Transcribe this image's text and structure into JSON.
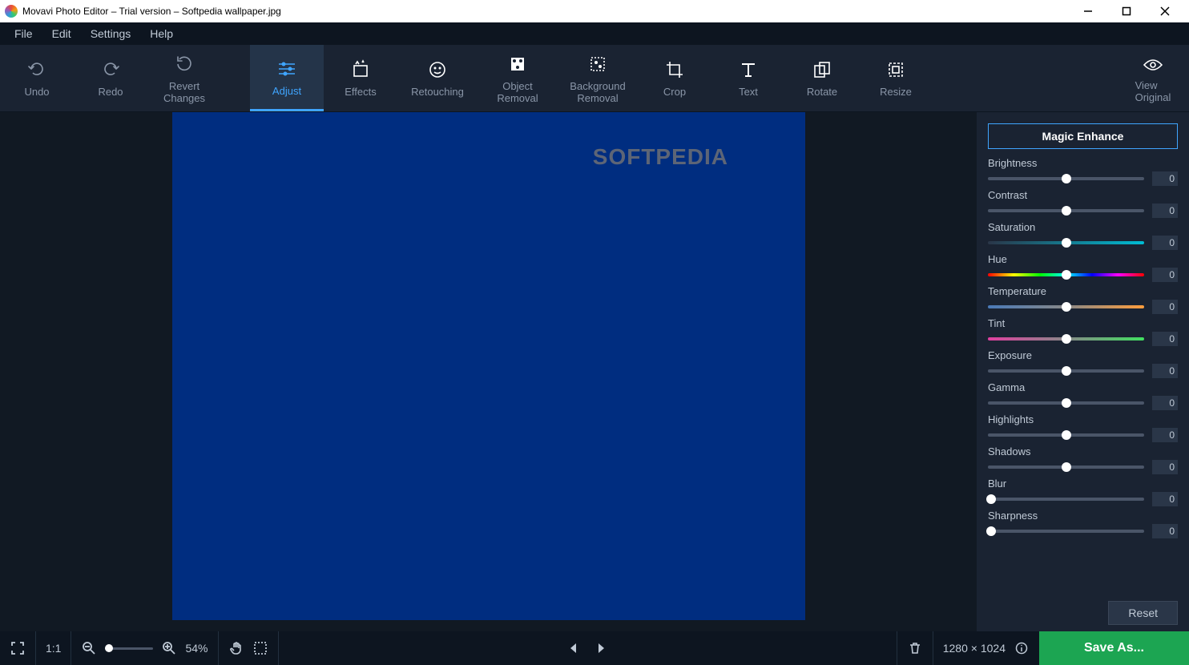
{
  "window": {
    "title": "Movavi Photo Editor – Trial version – Softpedia wallpaper.jpg"
  },
  "menu": {
    "file": "File",
    "edit": "Edit",
    "settings": "Settings",
    "help": "Help"
  },
  "toolbar": {
    "undo": "Undo",
    "redo": "Redo",
    "revert": "Revert\nChanges",
    "adjust": "Adjust",
    "effects": "Effects",
    "retouching": "Retouching",
    "object_removal": "Object\nRemoval",
    "background_removal": "Background\nRemoval",
    "crop": "Crop",
    "text": "Text",
    "rotate": "Rotate",
    "resize": "Resize",
    "view_original": "View\nOriginal"
  },
  "watermark": "SOFTPEDIA",
  "panel": {
    "magic_enhance": "Magic Enhance",
    "reset": "Reset",
    "sliders": {
      "brightness": {
        "label": "Brightness",
        "value": "0",
        "pos": 50
      },
      "contrast": {
        "label": "Contrast",
        "value": "0",
        "pos": 50
      },
      "saturation": {
        "label": "Saturation",
        "value": "0",
        "pos": 50
      },
      "hue": {
        "label": "Hue",
        "value": "0",
        "pos": 50
      },
      "temperature": {
        "label": "Temperature",
        "value": "0",
        "pos": 50
      },
      "tint": {
        "label": "Tint",
        "value": "0",
        "pos": 50
      },
      "exposure": {
        "label": "Exposure",
        "value": "0",
        "pos": 50
      },
      "gamma": {
        "label": "Gamma",
        "value": "0",
        "pos": 50
      },
      "highlights": {
        "label": "Highlights",
        "value": "0",
        "pos": 50
      },
      "shadows": {
        "label": "Shadows",
        "value": "0",
        "pos": 50
      },
      "blur": {
        "label": "Blur",
        "value": "0",
        "pos": 2
      },
      "sharpness": {
        "label": "Sharpness",
        "value": "0",
        "pos": 2
      }
    }
  },
  "status": {
    "scale_label": "1:1",
    "zoom_pct": "54%",
    "dimensions": "1280 × 1024",
    "save_as": "Save As..."
  }
}
